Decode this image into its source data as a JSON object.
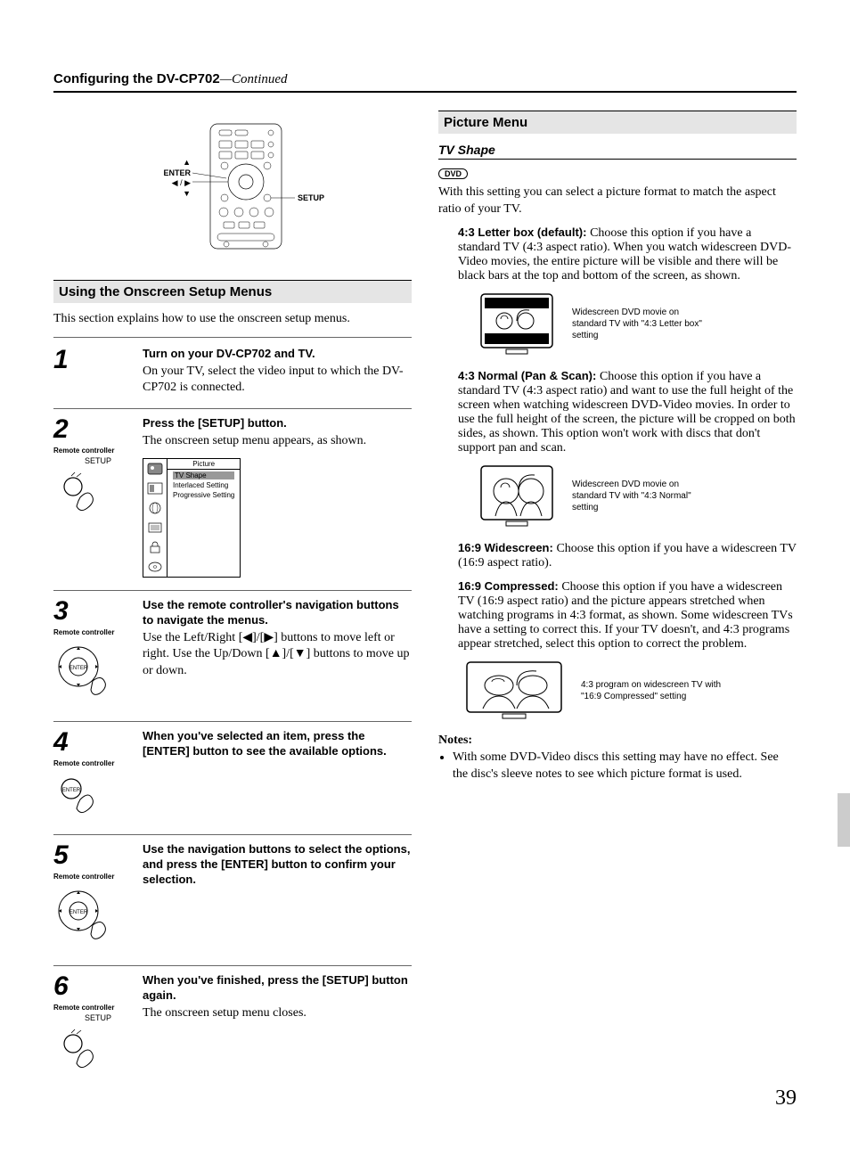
{
  "header": {
    "title_bold": "Configuring the DV-CP702",
    "title_cont": "—Continued"
  },
  "remote_diagram": {
    "labels": {
      "enter": "ENTER",
      "arrows": "◀ / ▶",
      "up": "▲",
      "down": "▼",
      "setup": "SETUP"
    }
  },
  "left": {
    "section_heading": "Using the Onscreen Setup Menus",
    "intro": "This section explains how to use the onscreen setup menus.",
    "steps": [
      {
        "num": "1",
        "bold": "Turn on your DV-CP702 and TV.",
        "body": "On your TV, select the video input to which the DV-CP702 is connected."
      },
      {
        "num": "2",
        "rc": "Remote controller",
        "setup": "SETUP",
        "bold": "Press the [SETUP] button.",
        "body": "The onscreen setup menu appears, as shown.",
        "osd": {
          "title": "Picture",
          "items": [
            "TV Shape",
            "Interlaced Setting",
            "Progressive Setting"
          ]
        }
      },
      {
        "num": "3",
        "rc": "Remote controller",
        "bold": "Use the remote controller's navigation buttons to navigate the menus.",
        "body": "Use the Left/Right [◀]/[▶] buttons to move left or right. Use the Up/Down [▲]/[▼] buttons to move up or down."
      },
      {
        "num": "4",
        "rc": "Remote controller",
        "bold": "When you've selected an item, press the [ENTER] button to see the available options."
      },
      {
        "num": "5",
        "rc": "Remote controller",
        "bold": "Use the navigation buttons to select the options, and press the [ENTER] button to confirm your selection."
      },
      {
        "num": "6",
        "rc": "Remote controller",
        "setup": "SETUP",
        "bold": "When you've finished, press the [SETUP] button again.",
        "body": "The onscreen setup menu closes."
      }
    ]
  },
  "right": {
    "section_heading": "Picture Menu",
    "sub_heading": "TV Shape",
    "badge": "DVD",
    "intro": "With this setting you can select a picture format to match the aspect ratio of your TV.",
    "opt1_label": "4:3 Letter box (default): ",
    "opt1_body": "Choose this option if you have a standard TV (4:3 aspect ratio). When you watch widescreen DVD-Video movies, the entire picture will be visible and there will be black bars at the top and bottom of the screen, as shown.",
    "cap1": "Widescreen DVD movie on standard TV with \"4:3 Letter box\" setting",
    "opt2_label": "4:3 Normal (Pan & Scan): ",
    "opt2_body": "Choose this option if you have a standard TV (4:3 aspect ratio) and want to use the full height of the screen when watching widescreen DVD-Video movies. In order to use the full height of the screen, the picture will be cropped on both sides, as shown. This option won't work with discs that don't support pan and scan.",
    "cap2": "Widescreen DVD movie on standard TV with \"4:3 Normal\" setting",
    "opt3_label": "16:9 Widescreen: ",
    "opt3_body": "Choose this option if you have a widescreen TV (16:9 aspect ratio).",
    "opt4_label": "16:9 Compressed: ",
    "opt4_body": "Choose this option if you have a widescreen TV (16:9 aspect ratio) and the picture appears stretched when watching programs in 4:3 format, as shown. Some widescreen TVs have a setting to correct this. If your TV doesn't, and 4:3 programs appear stretched, select this option to correct the problem.",
    "cap3": "4:3 program on widescreen TV with \"16:9 Compressed\" setting",
    "notes_heading": "Notes:",
    "note1": "With some DVD-Video discs this setting may have no effect. See the disc's sleeve notes to see which picture format is used."
  },
  "page_number": "39"
}
